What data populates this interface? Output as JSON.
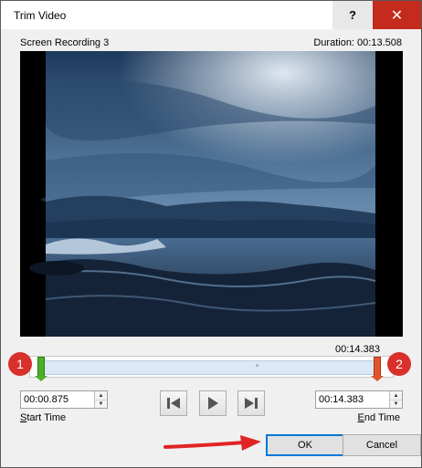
{
  "window": {
    "title": "Trim Video",
    "help_label": "?",
    "close_icon": "close-icon",
    "close_glyph": "✕"
  },
  "video": {
    "name": "Screen Recording 3",
    "duration": "Duration: 00:13.508",
    "end_readout": "00:14.383"
  },
  "annotations": {
    "badge_start": "1",
    "badge_end": "2"
  },
  "trim": {
    "start_value": "00:00.875",
    "end_value": "00:14.383",
    "start_fraction": 0.02,
    "end_fraction": 0.98,
    "start_label_key": "S",
    "start_label_rest": "tart Time",
    "end_label_key": "E",
    "end_label_rest": "nd Time"
  },
  "buttons": {
    "ok": "OK",
    "cancel": "Cancel"
  },
  "icons": {
    "previous_frame": "previous-frame-icon",
    "play": "play-icon",
    "next_frame": "next-frame-icon",
    "spin_up": "chevron-up-icon",
    "spin_down": "chevron-down-icon"
  },
  "colors": {
    "close": "#c42b1c",
    "badge": "#d9302c",
    "start_handle": "#4caf2a",
    "end_handle": "#e0562c",
    "ok_focus": "#0078d7",
    "arrow": "#e02424"
  }
}
